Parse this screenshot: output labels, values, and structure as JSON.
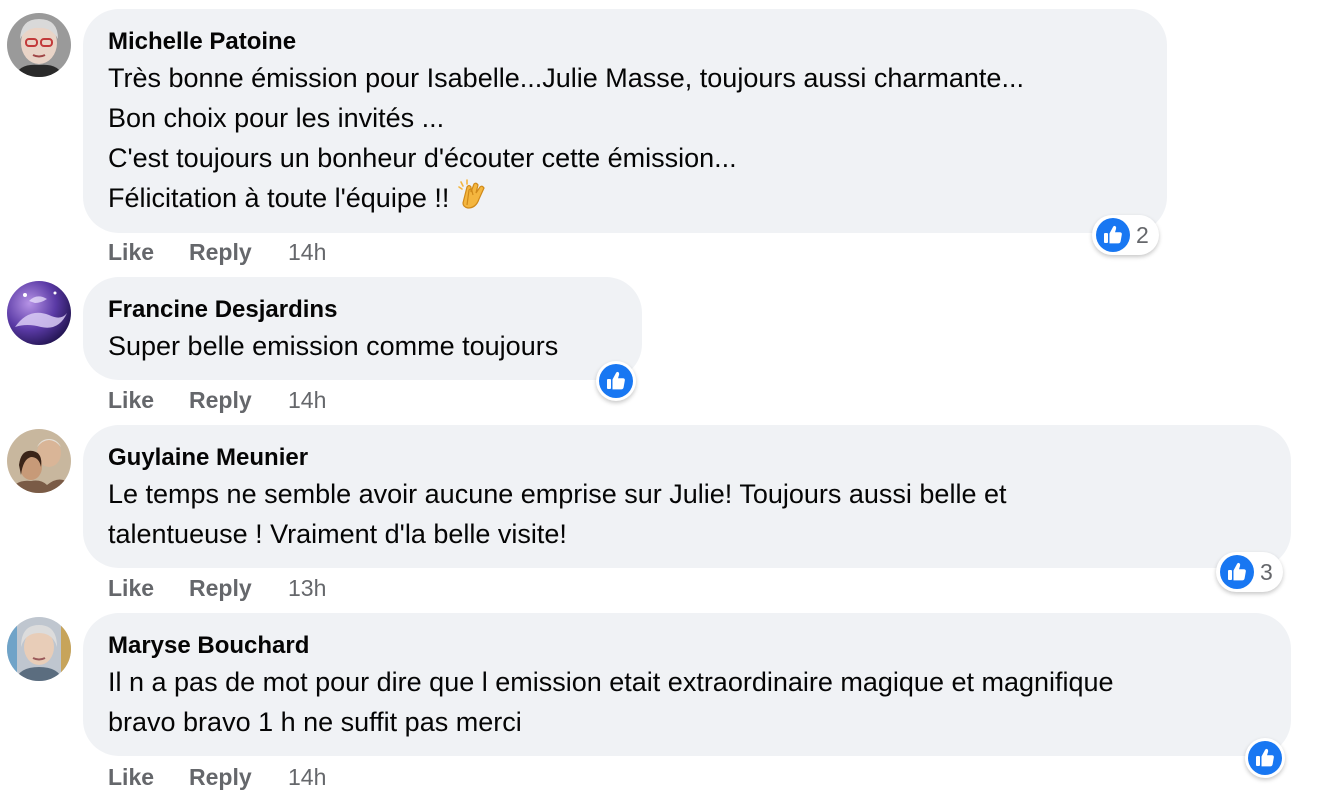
{
  "comments": [
    {
      "author": "Michelle Patoine",
      "lines": [
        "Très bonne émission pour Isabelle...Julie Masse, toujours aussi charmante...",
        "Bon choix pour les invités ...",
        "C'est toujours un bonheur d'écouter cette émission...",
        "Félicitation à toute l'équipe !!"
      ],
      "emoji": "clapping-hands",
      "reaction_count": "2",
      "like_label": "Like",
      "reply_label": "Reply",
      "time": "14h"
    },
    {
      "author": "Francine Desjardins",
      "lines": [
        "Super belle emission comme toujours"
      ],
      "reaction_count": "",
      "like_label": "Like",
      "reply_label": "Reply",
      "time": "14h"
    },
    {
      "author": "Guylaine Meunier",
      "lines": [
        "Le temps ne semble avoir aucune emprise sur Julie! Toujours aussi belle et",
        "talentueuse ! Vraiment d'la belle visite!"
      ],
      "reaction_count": "3",
      "like_label": "Like",
      "reply_label": "Reply",
      "time": "13h"
    },
    {
      "author": "Maryse Bouchard",
      "lines": [
        "Il n a pas de mot pour dire que l emission etait extraordinaire magique et magnifique",
        "bravo bravo 1 h ne suffit pas merci"
      ],
      "reaction_count": "",
      "like_label": "Like",
      "reply_label": "Reply",
      "time": "14h"
    }
  ],
  "colors": {
    "bubble": "#f0f2f5",
    "meta_text": "#65676b",
    "like_blue": "#1877f2",
    "text": "#050505"
  }
}
